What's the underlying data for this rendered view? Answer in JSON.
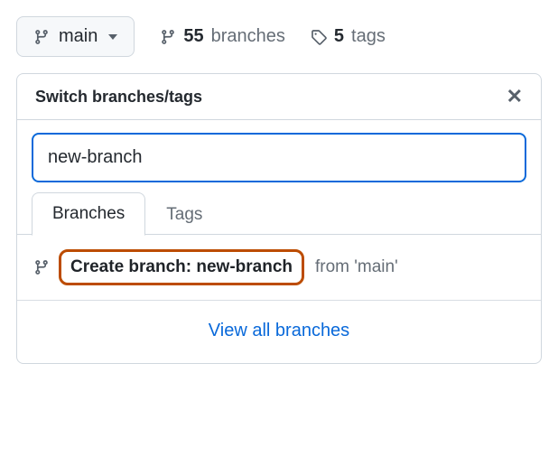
{
  "toprow": {
    "branch_btn_label": "main",
    "branches_count": "55",
    "branches_label": "branches",
    "tags_count": "5",
    "tags_label": "tags"
  },
  "popover": {
    "title": "Switch branches/tags",
    "search_value": "new-branch",
    "tabs": {
      "branches": "Branches",
      "tags": "Tags"
    },
    "create_prefix": "Create branch: ",
    "create_name": "new-branch",
    "create_from": " from 'main'",
    "view_all": "View all branches"
  }
}
